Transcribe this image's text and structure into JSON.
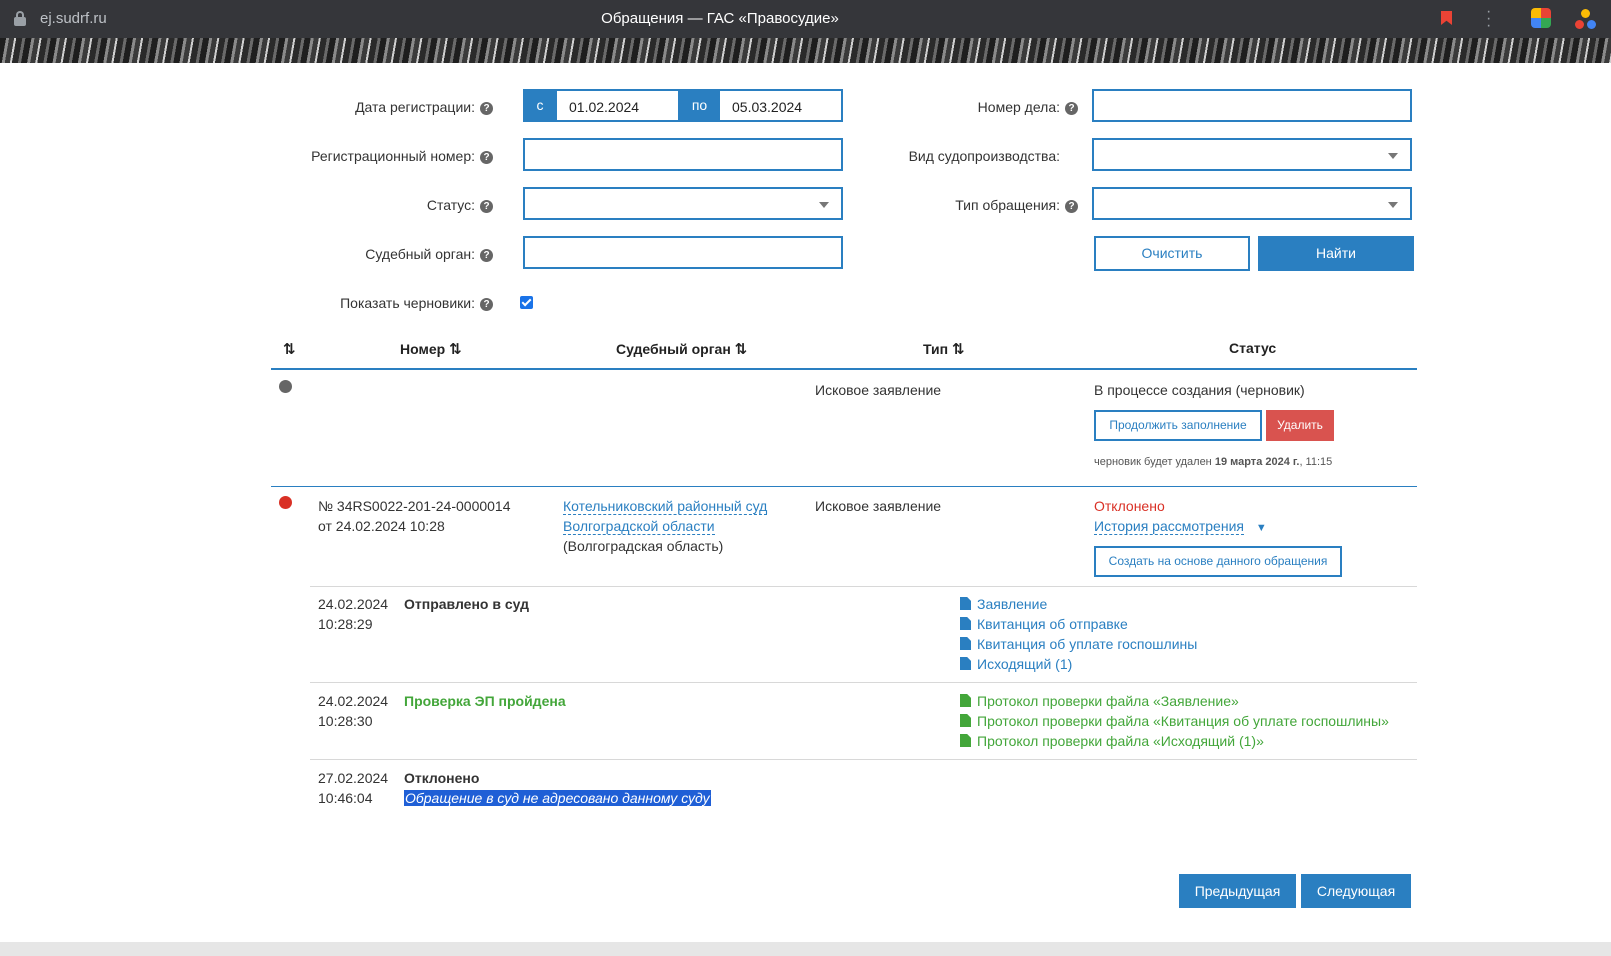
{
  "browser": {
    "url": "ej.sudrf.ru",
    "title": "Обращения — ГАС «Правосудие»"
  },
  "form": {
    "reg_date_label": "Дата регистрации:",
    "date_from_prefix": "с",
    "date_from": "01.02.2024",
    "date_to_prefix": "по",
    "date_to": "05.03.2024",
    "case_number_label": "Номер дела:",
    "case_number_value": "",
    "reg_number_label": "Регистрационный номер:",
    "reg_number_value": "",
    "proceeding_type_label": "Вид судопроизводства:",
    "proceeding_type_value": "",
    "status_label": "Статус:",
    "status_value": "",
    "appeal_type_label": "Тип обращения:",
    "appeal_type_value": "",
    "court_label": "Судебный орган:",
    "court_value": "",
    "clear_button": "Очистить",
    "find_button": "Найти",
    "show_drafts_label": "Показать черновики:",
    "show_drafts_checked": true
  },
  "table": {
    "headers": {
      "number": "Номер",
      "court": "Судебный орган",
      "type": "Тип",
      "status": "Статус"
    },
    "row1": {
      "type": "Исковое заявление",
      "status": "В процессе создания (черновик)",
      "continue_button": "Продолжить заполнение",
      "delete_button": "Удалить",
      "note_prefix": "черновик будет удален",
      "note_date": "19 марта 2024 г.",
      "note_time": ", 11:15"
    },
    "row2": {
      "number_line1": "№ 34RS0022-201-24-0000014",
      "number_line2": "от 24.02.2024 10:28",
      "court_line1": "Котельниковский районный суд",
      "court_line2": "Волгоградской области",
      "court_region": "(Волгоградская область)",
      "type": "Исковое заявление",
      "status": "Отклонено",
      "history_link": "История рассмотрения",
      "create_button": "Создать на основе данного обращения"
    },
    "history": [
      {
        "date": "24.02.2024",
        "time": "10:28:29",
        "event": "Отправлено в суд",
        "docs": [
          "Заявление",
          "Квитанция об отправке",
          "Квитанция об уплате госпошлины",
          "Исходящий (1)"
        ]
      },
      {
        "date": "24.02.2024",
        "time": "10:28:30",
        "event": "Проверка ЭП пройдена",
        "docs": [
          "Протокол проверки файла «Заявление»",
          "Протокол проверки файла «Квитанция об уплате госпошлины»",
          "Протокол проверки файла «Исходящий (1)»"
        ]
      },
      {
        "date": "27.02.2024",
        "time": "10:46:04",
        "event": "Отклонено",
        "reason": "Обращение в суд не адресовано данному суду"
      }
    ]
  },
  "pagination": {
    "prev": "Предыдущая",
    "next": "Следующая"
  }
}
